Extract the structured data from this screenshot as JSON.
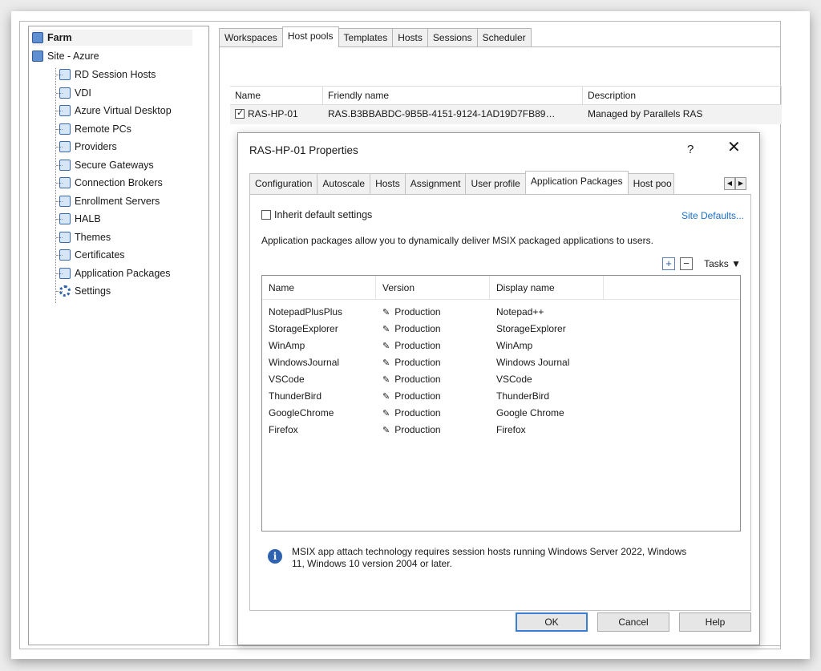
{
  "tree": {
    "farm": "Farm",
    "site": "Site - Azure",
    "items": [
      "RD Session Hosts",
      "VDI",
      "Azure Virtual Desktop",
      "Remote PCs",
      "Providers",
      "Secure Gateways",
      "Connection Brokers",
      "Enrollment Servers",
      "HALB",
      "Themes",
      "Certificates",
      "Application Packages",
      "Settings"
    ]
  },
  "main_tabs": [
    "Workspaces",
    "Host pools",
    "Templates",
    "Hosts",
    "Sessions",
    "Scheduler"
  ],
  "host_pools": {
    "headers": [
      "Name",
      "Friendly name",
      "Description"
    ],
    "rows": [
      {
        "name": "RAS-HP-01",
        "friendly": "RAS.B3BBABDC-9B5B-4151-9124-1AD19D7FB89…",
        "description": "Managed by Parallels RAS"
      }
    ]
  },
  "dialog": {
    "title": "RAS-HP-01 Properties",
    "help": "?",
    "close": "✕",
    "tabs": [
      "Configuration",
      "Autoscale",
      "Hosts",
      "Assignment",
      "User profile",
      "Application Packages",
      "Host poo"
    ],
    "inherit_label": "Inherit default settings",
    "site_defaults": "Site Defaults...",
    "description": "Application packages allow you to dynamically deliver MSIX packaged applications to users.",
    "tasks_label": "Tasks",
    "table_headers": [
      "Name",
      "Version",
      "Display name"
    ],
    "packages": [
      {
        "name": "NotepadPlusPlus",
        "version": "Production",
        "display": "Notepad++"
      },
      {
        "name": "StorageExplorer",
        "version": "Production",
        "display": "StorageExplorer"
      },
      {
        "name": "WinAmp",
        "version": "Production",
        "display": "WinAmp"
      },
      {
        "name": "WindowsJournal",
        "version": "Production",
        "display": "Windows Journal"
      },
      {
        "name": "VSCode",
        "version": "Production",
        "display": "VSCode"
      },
      {
        "name": "ThunderBird",
        "version": "Production",
        "display": "ThunderBird"
      },
      {
        "name": "GoogleChrome",
        "version": "Production",
        "display": "Google Chrome"
      },
      {
        "name": "Firefox",
        "version": "Production",
        "display": "Firefox"
      }
    ],
    "info_text": "MSIX app attach technology requires session hosts running Windows Server 2022, Windows 11, Windows 10 version 2004 or later.",
    "buttons": {
      "ok": "OK",
      "cancel": "Cancel",
      "help": "Help"
    }
  }
}
